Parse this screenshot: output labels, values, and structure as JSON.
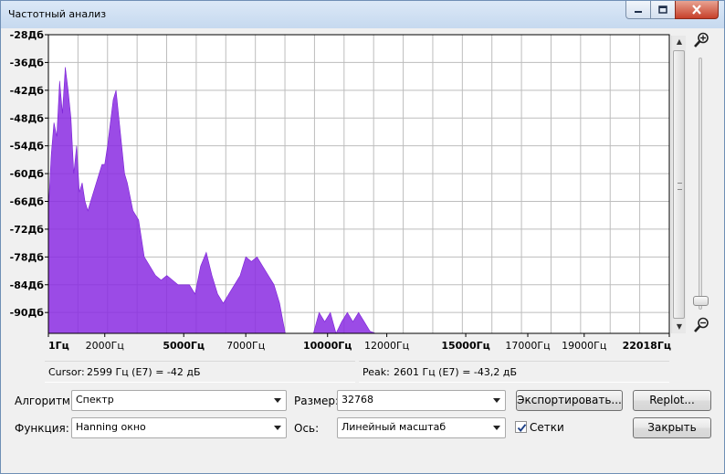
{
  "window": {
    "title": "Частотный анализ"
  },
  "chart_data": {
    "type": "area",
    "title": "",
    "xlabel": "",
    "ylabel": "",
    "xlim": [
      1,
      22018
    ],
    "ylim": [
      -92.5,
      -28
    ],
    "y_ticks": [
      "-28Дб",
      "-36Дб",
      "-42Дб",
      "-48Дб",
      "-54Дб",
      "-60Дб",
      "-66Дб",
      "-72Дб",
      "-78Дб",
      "-84Дб",
      "-90Дб"
    ],
    "y_tick_values": [
      -28,
      -34,
      -40,
      -46,
      -52,
      -58,
      -64,
      -70,
      -76,
      -82,
      -88
    ],
    "x_ticks": [
      "1Гц",
      "2000Гц",
      "5000Гц",
      "7000Гц",
      "10000Гц",
      "12000Гц",
      "15000Гц",
      "17000Гц",
      "19000Гц",
      "22018Гц"
    ],
    "x_tick_values": [
      1,
      2000,
      4800,
      7000,
      9900,
      12000,
      14800,
      17000,
      19000,
      22018
    ],
    "x_tick_bold": [
      true,
      false,
      true,
      false,
      true,
      false,
      true,
      false,
      false,
      true
    ],
    "grid": true,
    "fill_color": "#8a2be2",
    "series": [
      {
        "x": [
          0,
          100,
          200,
          300,
          400,
          500,
          600,
          700,
          800,
          900,
          1000,
          1100,
          1200,
          1300,
          1400,
          1500,
          1600,
          1700,
          1800,
          1900,
          2000,
          2100,
          2200,
          2300,
          2400,
          2500,
          2600,
          2700,
          2800,
          2900,
          3000,
          3200,
          3400,
          3600,
          3800,
          4000,
          4200,
          4400,
          4600,
          4800,
          5000,
          5200,
          5400,
          5600,
          5800,
          6000,
          6200,
          6400,
          6600,
          6800,
          7000,
          7200,
          7400,
          7600,
          7800,
          8000,
          8200,
          8400,
          8600,
          8800,
          9000,
          9200,
          9400,
          9600,
          9800,
          10000,
          10200,
          10400,
          10600,
          10800,
          11000,
          11200,
          11400,
          11600,
          11800
        ],
        "y": [
          -66,
          -54,
          -47,
          -50,
          -38,
          -45,
          -35,
          -40,
          -46,
          -58,
          -52,
          -62,
          -60,
          -64,
          -66,
          -64,
          -62,
          -60,
          -58,
          -56,
          -56,
          -52,
          -47,
          -42,
          -40,
          -46,
          -52,
          -58,
          -60,
          -63,
          -66,
          -68,
          -76,
          -78,
          -80,
          -81,
          -80,
          -81,
          -82,
          -82,
          -82,
          -84,
          -78,
          -75,
          -80,
          -84,
          -86,
          -84,
          -82,
          -80,
          -76,
          -77,
          -76,
          -78,
          -80,
          -82,
          -86,
          -92.5,
          -92.5,
          -92.5,
          -92.5,
          -92.5,
          -92.5,
          -88,
          -90,
          -88,
          -92.5,
          -90,
          -88,
          -90,
          -88,
          -90,
          -92,
          -92.5,
          -92.5
        ]
      }
    ]
  },
  "scrollbar": {
    "up_arrow": "▲",
    "down_arrow": "▼"
  },
  "zoom": {
    "in_icon": "zoom-in-icon",
    "out_icon": "zoom-out-icon",
    "level_fraction": 0.08
  },
  "readout": {
    "cursor_label": "Cursor:",
    "cursor_value": "2599 Гц (E7) = -42 дБ",
    "peak_label": "Peak:",
    "peak_value": "2601 Гц (E7) = -43,2 дБ"
  },
  "controls": {
    "algorithm_label": "Алгоритм:",
    "algorithm_value": "Спектр",
    "function_label": "Функция:",
    "function_value": "Hanning окно",
    "size_label": "Размер:",
    "size_value": "32768",
    "axis_label": "Ось:",
    "axis_value": "Линейный масштаб",
    "grid_label": "Сетки",
    "grid_checked": true,
    "export_button": "Экспортировать...",
    "replot_button": "Replot...",
    "close_button": "Закрыть"
  }
}
